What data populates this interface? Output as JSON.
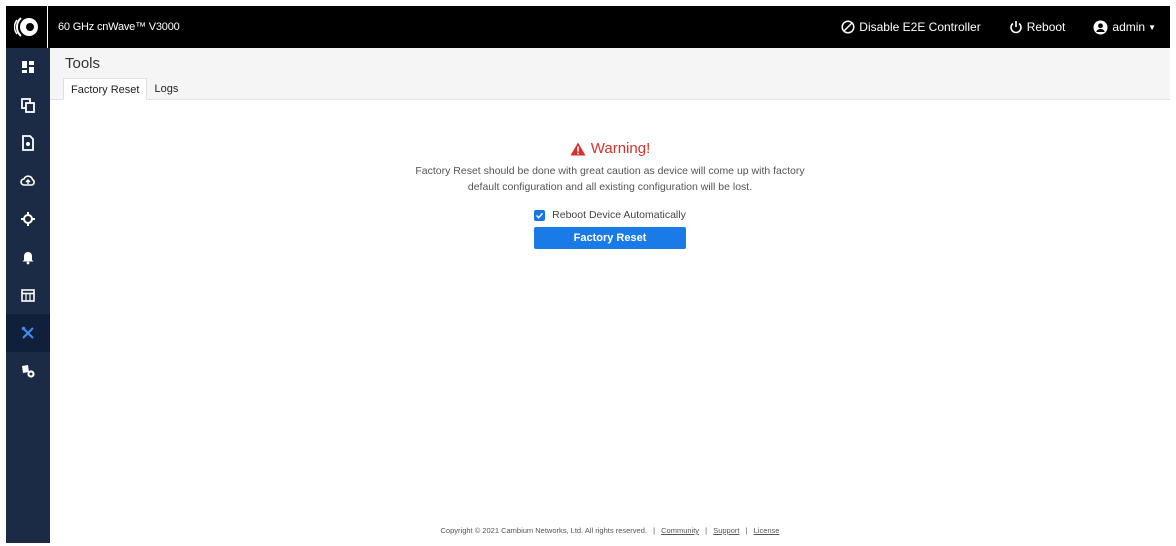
{
  "topbar": {
    "app_title": "60 GHz cnWave™ V3000",
    "disable_e2e_label": "Disable E2E Controller",
    "reboot_label": "Reboot",
    "user_label": "admin"
  },
  "sidebar": {
    "items": [
      {
        "icon": "dashboard-icon"
      },
      {
        "icon": "copy-icon"
      },
      {
        "icon": "file-icon"
      },
      {
        "icon": "cloud-upload-icon"
      },
      {
        "icon": "crosshair-icon"
      },
      {
        "icon": "bell-icon"
      },
      {
        "icon": "calendar-icon"
      },
      {
        "icon": "tools-icon",
        "active": true
      },
      {
        "icon": "settings-icon"
      }
    ]
  },
  "page": {
    "title": "Tools",
    "tabs": [
      {
        "label": "Factory Reset",
        "active": true
      },
      {
        "label": "Logs",
        "active": false
      }
    ]
  },
  "warning": {
    "title": "Warning!",
    "text": "Factory Reset should be done with great caution as device will come up with factory default configuration and all existing configuration will be lost."
  },
  "reboot_checkbox": {
    "label": "Reboot Device Automatically",
    "checked": true
  },
  "factory_reset_button": "Factory Reset",
  "footer": {
    "copyright": "Copyright © 2021 Cambium Networks, Ltd. All rights reserved.",
    "links": [
      "Community",
      "Support",
      "License"
    ]
  },
  "colors": {
    "topbar": "#000000",
    "sidebar": "#1c2b45",
    "accent": "#1a7ae8",
    "warning": "#d9302d"
  }
}
